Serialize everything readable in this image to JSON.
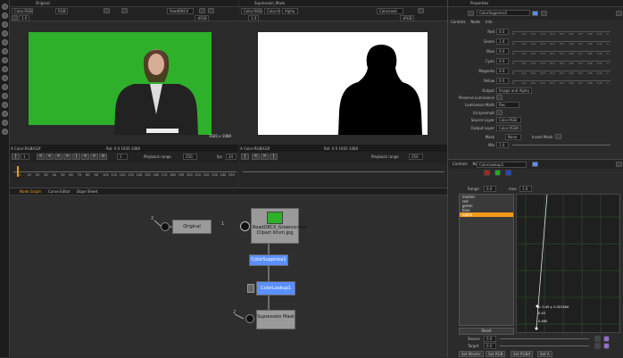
{
  "left_toolbar_icons": [
    "selection-icon",
    "viewer-icon",
    "grid-icon",
    "tool-icon",
    "tool-icon",
    "tool-icon",
    "tool-icon",
    "tool-icon",
    "tool-icon",
    "tool-icon",
    "tool-icon",
    "tool-icon",
    "tool-icon",
    "tool-icon",
    "tool-icon"
  ],
  "viewer_left": {
    "title": "Original",
    "color_mode": "Color.RGB",
    "channel": "RGB",
    "zoom": "1.0",
    "proxy": "ReadOKCX",
    "colorspace": "sRGB",
    "info_left": "A Color:RGBA32f",
    "info_mid": "RoI: 0 0 1920 1080",
    "resolution": "1920 x 1080"
  },
  "viewer_right": {
    "title": "Supression_Mask",
    "color_mode": "Color.RGB",
    "channel_a": "Color.A",
    "channel_b": "Alpha",
    "zoom": "1.0",
    "proxy": "ColorLook",
    "colorspace": "sRGB",
    "info_left": "A Color:RGBA32f",
    "info_mid": "RoI: 0 0 1920 1080"
  },
  "playback": {
    "label": "Playback range",
    "start": "1",
    "end": "250",
    "fps": "fps",
    "fps_value": "24",
    "frame": "1"
  },
  "timeline_ticks": [
    "1",
    "10",
    "20",
    "30",
    "40",
    "50",
    "60",
    "70",
    "80",
    "90",
    "100",
    "110",
    "120",
    "130",
    "140",
    "150",
    "160",
    "170",
    "180",
    "190",
    "200",
    "210",
    "220",
    "230",
    "240",
    "250"
  ],
  "panel_tabs": {
    "node_graph": "Node Graph",
    "curve_editor": "Curve Editor",
    "dope_sheet": "Dope Sheet"
  },
  "nodes": {
    "original": "Original",
    "read": "ReadOKCX_Greenscreen Clipart Krum.jpg",
    "color_suppress": "ColorSuppress1",
    "color_lookup": "ColorLookup1",
    "mask": "Supression Mask",
    "input_2a": "2",
    "input_1": "1",
    "input_2b": "2"
  },
  "properties": {
    "title": "Properties",
    "node_name": "ColorSuppress1",
    "tabs": [
      "Controls",
      "Node",
      "Info"
    ],
    "rows": [
      {
        "label": "Red",
        "value": "0.0"
      },
      {
        "label": "Green",
        "value": "1.0"
      },
      {
        "label": "Blue",
        "value": "0.0"
      },
      {
        "label": "Cyan",
        "value": "0.0"
      },
      {
        "label": "Magenta",
        "value": "0.0"
      },
      {
        "label": "Yellow",
        "value": "0.0"
      }
    ],
    "scale": [
      "0",
      "0.1",
      "0.2",
      "0.3",
      "0.4",
      "0.5",
      "0.6",
      "0.7",
      "0.8",
      "0.9",
      "1"
    ],
    "output_label": "Output",
    "output_value": "Image and Alpha",
    "preserve_lum_label": "Preserve Luminance",
    "lum_math_label": "Luminance Math",
    "lum_math_value": "Rec.",
    "unpremult_label": "(Un)premult",
    "source_layer_label": "Source Layer",
    "source_layer_value": "Color.RGB",
    "output_layer_label": "Output Layer",
    "output_layer_value": "Color.RGBA",
    "mask_label": "Mask",
    "mask_value": "None",
    "invert_label": "Invert Mask",
    "mix_label": "Mix",
    "mix_value": "1.0"
  },
  "lookup": {
    "node_name": "ColorLookup1",
    "tabs": [
      "Controls",
      "Node",
      "Info"
    ],
    "range_label": "Range",
    "range_min": "0.0",
    "range_max_label": "max",
    "range_max": "1.0",
    "channels": [
      "master",
      "red",
      "green",
      "blue",
      "alpha"
    ],
    "selected": "alpha",
    "annot1": "x: 0.45  y: 0.321564",
    "annot2": "0.45",
    "annot3": "0.465",
    "reset_label": "Reset",
    "source_label": "Source",
    "source_value": "0.0",
    "target_label": "Target",
    "target_value": "0.0",
    "btn_set_master": "Set Master",
    "btn_set_rgb": "Set RGB",
    "btn_set_rgba": "Set RGBA",
    "btn_set_a": "Set A"
  },
  "colors": {
    "green_screen": "#2fb02a",
    "accent_blue": "#5a8fff",
    "selected_orange": "#f39a1a",
    "panel_bg": "#2b2b2b",
    "toolbar_bg": "#1e1e1e"
  }
}
